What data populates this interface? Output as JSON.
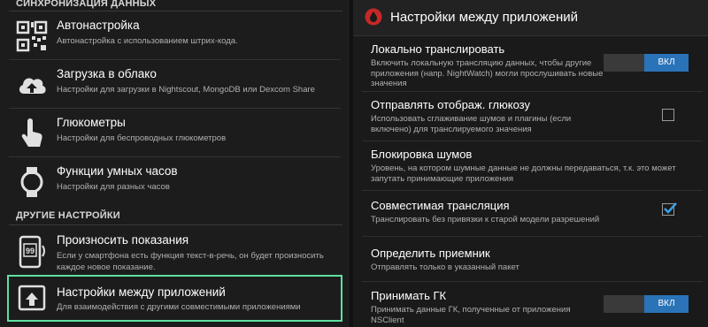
{
  "left_panel": {
    "section_sync": "СИНХРОНИЗАЦИЯ ДАННЫХ",
    "section_other": "ДРУГИЕ НАСТРОЙКИ",
    "items": [
      {
        "title": "Автонастройка",
        "subtitle": "Автонастройка с использованием штрих-кода.",
        "icon": "qr-code-icon"
      },
      {
        "title": "Загрузка в облако",
        "subtitle": "Настройки для загрузки в Nightscout, MongoDB или Dexcom Share",
        "icon": "cloud-upload-icon"
      },
      {
        "title": "Глюкометры",
        "subtitle": "Настройки для беспроводных глюкометров",
        "icon": "touch-hand-icon"
      },
      {
        "title": "Функции умных часов",
        "subtitle": "Настройки для разных часов",
        "icon": "smartwatch-icon"
      },
      {
        "title": "Произносить показания",
        "subtitle": "Если у смартфона есть функция текст-в-речь, он будет произносить каждое новое показание.",
        "icon": "speak-phone-icon",
        "icon_text": "99"
      },
      {
        "title": "Настройки между приложений",
        "subtitle": "Для взаимодействия с другими совместимыми приложениями",
        "icon": "share-upload-icon"
      }
    ]
  },
  "right_panel": {
    "header_title": "Настройки между приложений",
    "items": [
      {
        "title": "Локально транслировать",
        "subtitle": "Включить локальную трансляцию данных, чтобы другие приложения (напр. NightWatch) могли прослушивать новые значения",
        "control": "toggle",
        "toggle_label": "ВКЛ"
      },
      {
        "title": "Отправлять отображ. глюкозу",
        "subtitle": "Использовать сглаживание шумов и плагины (если включено) для транслируемого значения",
        "control": "checkbox",
        "checked": false
      },
      {
        "title": "Блокировка шумов",
        "subtitle": "Уровень, на котором шумные данные не должны передаваться, т.к. это может запутать принимающие приложения",
        "control": "none"
      },
      {
        "title": "Совместимая трансляция",
        "subtitle": "Транслировать без привязки к старой модели разрешений",
        "control": "checkbox",
        "checked": true
      },
      {
        "title": "Определить приемник",
        "subtitle": "Отправлять только в указанный пакет",
        "control": "none"
      },
      {
        "title": "Принимать ГК",
        "subtitle": "Принимать данные ГК, полученные от приложения NSClient",
        "control": "toggle",
        "toggle_label": "ВКЛ"
      }
    ]
  },
  "colors": {
    "accent_toggle": "#2a73b8",
    "selection_border": "#5fe0a0",
    "header_drop": "#c62828",
    "checkmark": "#3aa0e8"
  }
}
